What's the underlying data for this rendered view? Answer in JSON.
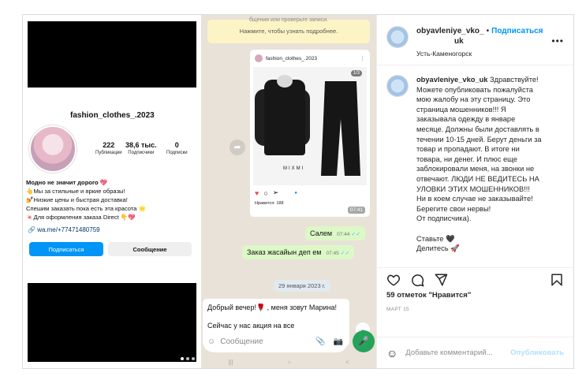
{
  "post": {
    "author": "obyavleniye_vko_uk",
    "author_line1": "obyavleniye_vko_",
    "author_line2": "uk",
    "follow_label": "Подписаться",
    "location": "Усть-Каменогорск",
    "more_label": "•••",
    "caption_author": "obyavleniye_vko_uk",
    "caption_lines": [
      "Здравствуйте!",
      "Можете опубликовать пожалуйста",
      "мою жалобу на эту страницу. Это",
      "страница мошенников!!! Я",
      "заказывала одежду в январе",
      "месяце. Должны были доставлять в",
      "течении 10-15 дней. Берут деньги за",
      "товар и пропадают. В итоге ни",
      "товара, ни денег. И плюс еще",
      "заблокировали меня, на звонки не",
      "отвечают. ЛЮДИ НЕ ВЕДИТЕСЬ НА",
      "УЛОВКИ ЭТИХ МОШЕННИКОВ!!!",
      "Ни в коем случае не заказывайте!",
      "Берегите свои нервы!",
      "От подписчика).",
      "",
      "Ставьте 🖤",
      "Делитесь 🚀"
    ],
    "likes": "59 отметок \"Нравится\"",
    "date": "МАРТ 15",
    "comment_placeholder": "Добавьте комментарий...",
    "publish_label": "Опубликовать"
  },
  "profile_screenshot": {
    "username": "fashion_clothes_.2023",
    "posts_count": "222",
    "posts_label": "Публикации",
    "followers_count": "38,6 тыс.",
    "followers_label": "Подписчики",
    "following_count": "0",
    "following_label": "Подписки",
    "bio_bold": "Модно не значит дорого 💖",
    "bio_lines": [
      "👆Мы за стильные и яркие образы!",
      "💅Низкие цены и быстрая доставка!",
      "Спешим заказать пока есть эта красота 🌟",
      "🍬Для оформления заказа Direct 👇💖"
    ],
    "link": "wa.me/+77471480759",
    "follow_button": "Подписаться",
    "message_button": "Сообщение"
  },
  "chat_screenshot": {
    "system_top": "бщения или проверьте записи.",
    "system_text": "Нажмите, чтобы узнать подробнее.",
    "card_user": "fashion_clothes_.2023",
    "card_counter": "1/3",
    "card_brand": "MIXMI",
    "card_likes": "Нравится: 188",
    "card_time": "07:41",
    "msg1_text": "Салем",
    "msg1_time": "07:44",
    "msg2_text": "Заказ жасайын деп ем",
    "msg2_time": "07:45",
    "date_pill": "29 января 2023 г.",
    "incoming_text": "Добрый вечер!🌹 , меня зовут Марина!",
    "incoming_text2": "Сейчас у нас акция на все",
    "composer_placeholder": "Сообщение",
    "ticks": "✓✓"
  }
}
